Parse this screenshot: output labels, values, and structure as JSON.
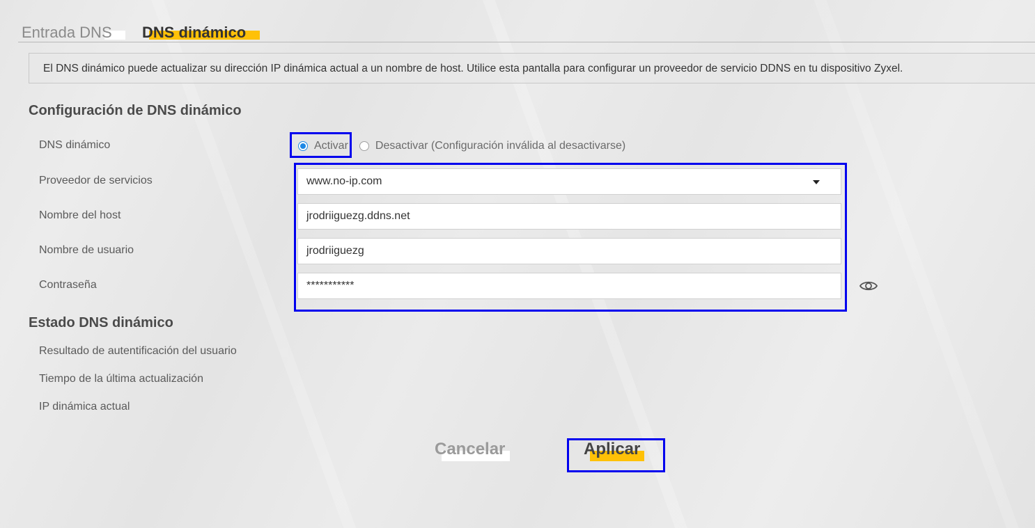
{
  "tabs": {
    "dns_entry": "Entrada DNS",
    "dynamic_dns": "DNS dinámico"
  },
  "info": {
    "text": "El DNS dinámico puede actualizar su dirección IP dinámica actual a un nombre de host. Utilice esta pantalla para configurar un proveedor de servicio DDNS en tu dispositivo Zyxel."
  },
  "config": {
    "title": "Configuración de DNS dinámico",
    "ddns_label": "DNS dinámico",
    "enable_label": "Activar",
    "disable_label": "Desactivar (Configuración inválida al desactivarse)",
    "enabled": true,
    "provider_label": "Proveedor de servicios",
    "provider_value": "www.no-ip.com",
    "hostname_label": "Nombre del host",
    "hostname_value": "jrodriiguezg.ddns.net",
    "username_label": "Nombre de usuario",
    "username_value": "jrodriiguezg",
    "password_label": "Contraseña",
    "password_value": "***********"
  },
  "status": {
    "title": "Estado DNS dinámico",
    "auth_result_label": "Resultado de autentificación del usuario",
    "last_update_label": "Tiempo de la última actualización",
    "current_ip_label": "IP dinámica actual"
  },
  "buttons": {
    "cancel": "Cancelar",
    "apply": "Aplicar"
  },
  "colors": {
    "accent_yellow": "#ffc107",
    "highlight_blue": "#0000ee",
    "radio_blue": "#1e88e5"
  }
}
